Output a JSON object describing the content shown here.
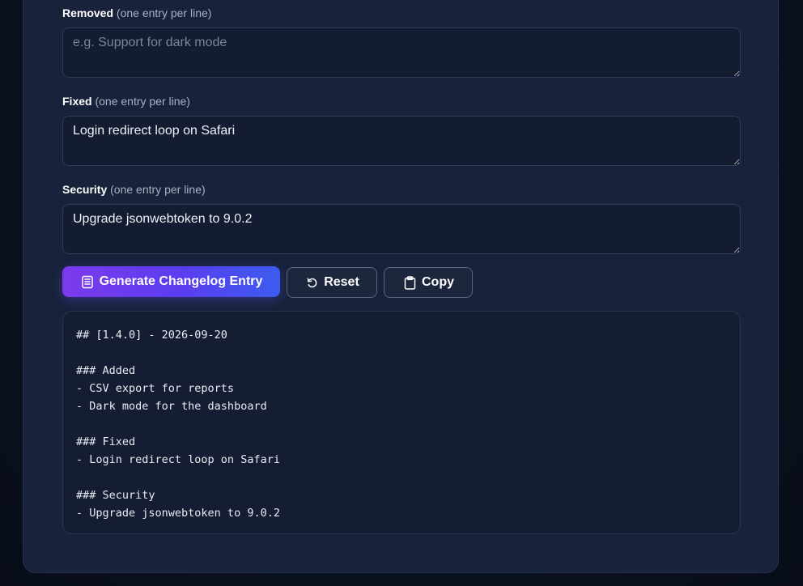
{
  "fields": {
    "removed": {
      "label": "Removed",
      "hint": "(one entry per line)",
      "value": "",
      "placeholder": "e.g. Support for dark mode"
    },
    "fixed": {
      "label": "Fixed",
      "hint": "(one entry per line)",
      "value": "Login redirect loop on Safari",
      "placeholder": ""
    },
    "security": {
      "label": "Security",
      "hint": "(one entry per line)",
      "value": "Upgrade jsonwebtoken to 9.0.2",
      "placeholder": ""
    }
  },
  "actions": {
    "generate_label": "Generate Changelog Entry",
    "generate_icon": "document-list-icon",
    "reset_label": "Reset",
    "reset_icon": "reset-icon",
    "copy_label": "Copy",
    "copy_icon": "clipboard-icon"
  },
  "output": {
    "text": "## [1.4.0] - 2026-09-20\n\n### Added\n- CSV export for reports\n- Dark mode for the dashboard\n\n### Fixed\n- Login redirect loop on Safari\n\n### Security\n- Upgrade jsonwebtoken to 9.0.2"
  },
  "colors": {
    "background": "#0b1220",
    "card": "#18223a",
    "accent_start": "#7c3aed",
    "accent_end": "#3b5cf0"
  }
}
